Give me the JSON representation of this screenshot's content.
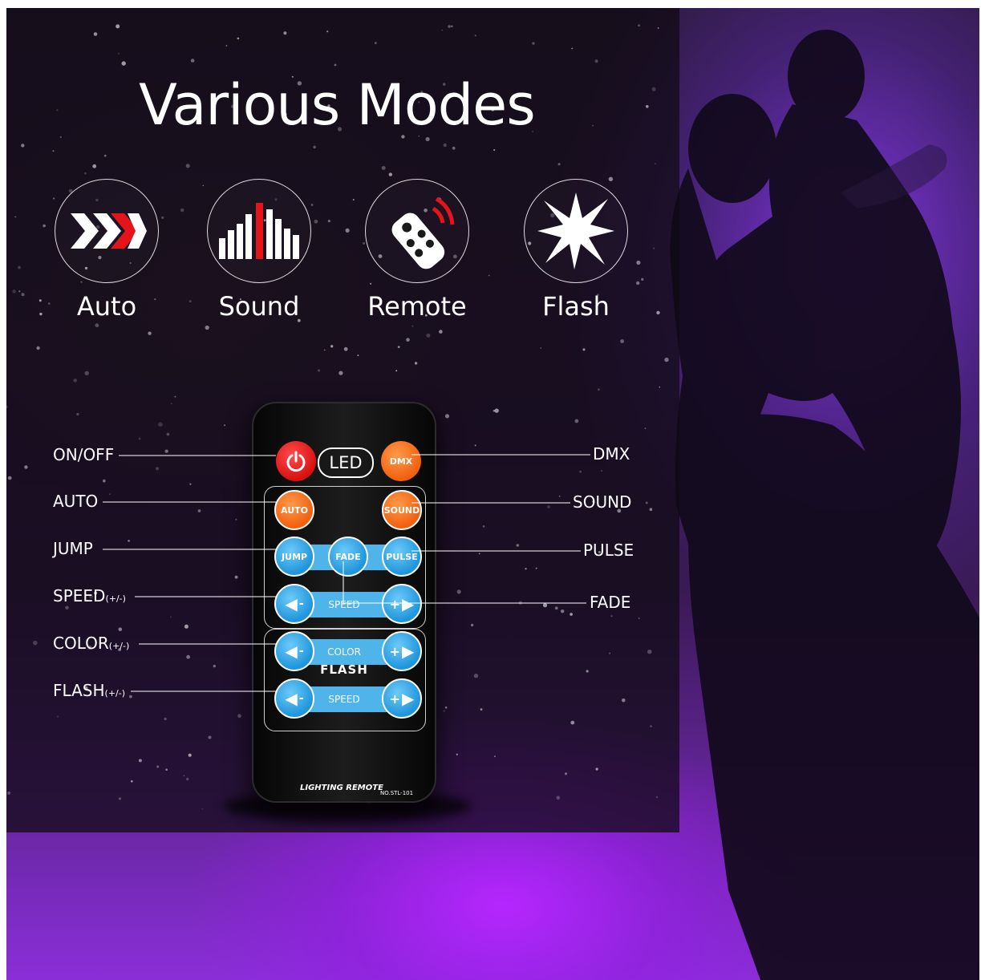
{
  "title": "Various Modes",
  "modes": [
    {
      "label": "Auto",
      "icon": "chevron-arrows-icon"
    },
    {
      "label": "Sound",
      "icon": "equalizer-bars-icon"
    },
    {
      "label": "Remote",
      "icon": "remote-control-icon"
    },
    {
      "label": "Flash",
      "icon": "starburst-icon"
    }
  ],
  "remote": {
    "led_label": "LED",
    "buttons": {
      "dmx": "DMX",
      "auto": "AUTO",
      "sound": "SOUND",
      "jump": "JUMP",
      "fade": "FADE",
      "pulse": "PULSE",
      "speed": "SPEED",
      "color": "COLOR",
      "flash_speed": "SPEED",
      "minus": "-",
      "plus": "+"
    },
    "flash_label": "FLASH",
    "brand": "LIGHTING   REMOTE",
    "model": "NO.STL-101"
  },
  "callouts": {
    "onoff": "ON/OFF",
    "auto": "AUTO",
    "jump": "JUMP",
    "speed": "SPEED",
    "speed_sub": "(+/-)",
    "color": "COLOR",
    "color_sub": "(+/-)",
    "flash": "FLASH",
    "flash_sub": "(+/-)",
    "dmx": "DMX",
    "sound": "SOUND",
    "pulse": "PULSE",
    "fade": "FADE"
  },
  "colors": {
    "accent_orange": "#f06010",
    "accent_blue": "#4fb4ea",
    "power_red": "#d81010",
    "purple_glow": "#b526ff"
  }
}
